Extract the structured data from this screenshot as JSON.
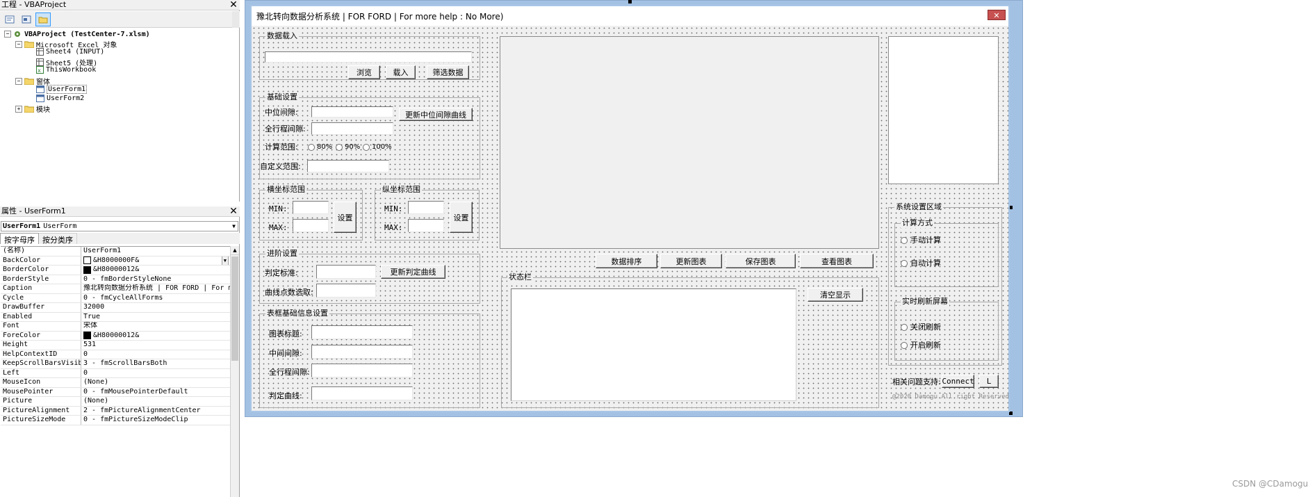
{
  "project_panel": {
    "title": "工程 - VBAProject",
    "close": "✕",
    "tree": {
      "root": "VBAProject (TestCenter-7.xlsm)",
      "excel_objects": "Microsoft Excel 对象",
      "sheets": [
        "Sheet4 (INPUT)",
        "Sheet5 (处理)",
        "ThisWorkbook"
      ],
      "forms_folder": "窗体",
      "forms": [
        "UserForm1",
        "UserForm2"
      ],
      "modules_folder": "模块"
    },
    "expanders": {
      "root": "−",
      "excel": "−",
      "forms": "−",
      "modules": "+"
    }
  },
  "properties_panel": {
    "title": "属性 - UserForm1",
    "close": "✕",
    "object_name": "UserForm1",
    "object_type": "UserForm",
    "tabs": [
      "按字母序",
      "按分类序"
    ],
    "rows": [
      {
        "name": "(名称)",
        "value": "UserForm1"
      },
      {
        "name": "BackColor",
        "value": "&H8000000F&",
        "swatch": "#ffffff"
      },
      {
        "name": "BorderColor",
        "value": "&H80000012&",
        "swatch": "#000000"
      },
      {
        "name": "BorderStyle",
        "value": "0 - fmBorderStyleNone"
      },
      {
        "name": "Caption",
        "value": "豫北转向数据分析系统 | FOR FORD    |  For m"
      },
      {
        "name": "Cycle",
        "value": "0 - fmCycleAllForms"
      },
      {
        "name": "DrawBuffer",
        "value": "32000"
      },
      {
        "name": "Enabled",
        "value": "True"
      },
      {
        "name": "Font",
        "value": "宋体"
      },
      {
        "name": "ForeColor",
        "value": "&H80000012&",
        "swatch": "#000000"
      },
      {
        "name": "Height",
        "value": "531"
      },
      {
        "name": "HelpContextID",
        "value": "0"
      },
      {
        "name": "KeepScrollBarsVisible",
        "value": "3 - fmScrollBarsBoth"
      },
      {
        "name": "Left",
        "value": "0"
      },
      {
        "name": "MouseIcon",
        "value": "(None)"
      },
      {
        "name": "MousePointer",
        "value": "0 - fmMousePointerDefault"
      },
      {
        "name": "Picture",
        "value": "(None)"
      },
      {
        "name": "PictureAlignment",
        "value": "2 - fmPictureAlignmentCenter"
      },
      {
        "name": "PictureSizeMode",
        "value": "0 - fmPictureSizeModeClip"
      }
    ]
  },
  "form": {
    "title": "豫北转向数据分析系统 | FOR FORD    | For more help : No More)",
    "close": "✕",
    "data_load": {
      "label": "数据载入",
      "browse": "浏览",
      "load": "载入",
      "filter": "筛选数据"
    },
    "basic": {
      "label": "基础设置",
      "center_gap": "中位间隙:",
      "update_center": "更新中位间隙曲线",
      "full_gap": "全行程间隙:",
      "calc_range": "计算范围:",
      "options": [
        "80%",
        "90%",
        "100%"
      ],
      "custom_range": "自定义范围:"
    },
    "x_axis": {
      "label": "横坐标范围",
      "min": "MIN:",
      "max": "MAX:",
      "set": "设置"
    },
    "y_axis": {
      "label": "纵坐标范围",
      "min": "MIN:",
      "max": "MAX:",
      "set": "设置"
    },
    "advanced": {
      "label": "进阶设置",
      "criterion": "判定标准:",
      "update_criterion": "更新判定曲线",
      "curve_points": "曲线点数选取:"
    },
    "table_info": {
      "label": "表框基础信息设置",
      "chart_title": "图表标题:",
      "middle_gap": "中间间隙:",
      "full_gap": "全行程间隙:",
      "criterion_curve": "判定曲线:"
    },
    "chart_buttons": [
      "数据排序",
      "更新图表",
      "保存图表",
      "查看图表"
    ],
    "status": {
      "label": "状态栏",
      "clear": "清空显示"
    },
    "system": {
      "label": "系统设置区域",
      "calc_mode": {
        "label": "计算方式",
        "manual": "手动计算",
        "auto": "自动计算"
      },
      "refresh": {
        "label": "实时刷新屏幕",
        "off": "关闭刷新",
        "on": "开启刷新"
      }
    },
    "support": {
      "label": "相关问题支持:",
      "connect": "Connect",
      "l": "L"
    },
    "copyright": "@2020 Damogu.All right Reserved"
  },
  "watermark": "CSDN @CDamogu",
  "colors": {
    "form_title_bg": "#ffffff",
    "form_border": "#a9c6e6",
    "close_red": "#c75050",
    "selected_row": "#0a246a"
  }
}
